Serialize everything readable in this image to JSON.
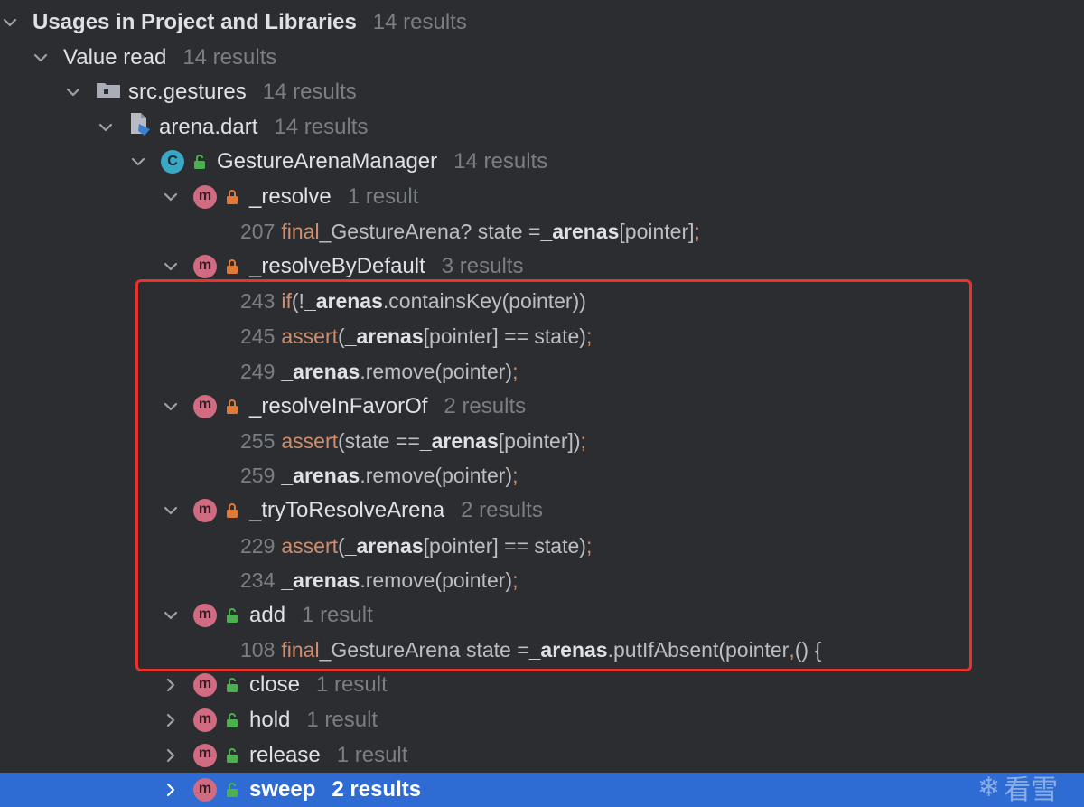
{
  "window": {
    "tree": [
      {
        "type": "node",
        "indent": 0,
        "expanded": true,
        "icon": "none",
        "name": "Usages in Project and Libraries",
        "count": "14 results",
        "bold": true
      },
      {
        "type": "node",
        "indent": 1,
        "expanded": true,
        "icon": "none",
        "name": "Value read",
        "count": "14 results"
      },
      {
        "type": "node",
        "indent": 2,
        "expanded": true,
        "icon": "folder-icon",
        "name": "src.gestures",
        "count": "14 results"
      },
      {
        "type": "node",
        "indent": 3,
        "expanded": true,
        "icon": "dart-file-icon",
        "name": "arena.dart",
        "count": "14 results"
      },
      {
        "type": "node",
        "indent": 4,
        "expanded": true,
        "icon": "class-icon",
        "access": "public",
        "name": "GestureArenaManager",
        "count": "14 results"
      },
      {
        "type": "node",
        "indent": 5,
        "expanded": true,
        "icon": "method-icon",
        "access": "private",
        "name": "_resolve",
        "count": "1 result"
      },
      {
        "type": "code",
        "line": "207",
        "tokens": [
          {
            "t": "final",
            "c": "kw"
          },
          {
            "t": " _GestureArena? state = ",
            "c": "pl"
          },
          {
            "t": "_arenas",
            "c": "hl"
          },
          {
            "t": "[pointer]",
            "c": "pl"
          },
          {
            "t": ";",
            "c": "kw"
          }
        ]
      },
      {
        "type": "node",
        "indent": 5,
        "expanded": true,
        "icon": "method-icon",
        "access": "private",
        "name": "_resolveByDefault",
        "count": "3 results"
      },
      {
        "type": "code",
        "line": "243",
        "tokens": [
          {
            "t": "if",
            "c": "kw"
          },
          {
            "t": " (!",
            "c": "pl"
          },
          {
            "t": "_arenas",
            "c": "hl"
          },
          {
            "t": ".containsKey(pointer))",
            "c": "pl"
          }
        ]
      },
      {
        "type": "code",
        "line": "245",
        "tokens": [
          {
            "t": "assert",
            "c": "kw"
          },
          {
            "t": "(",
            "c": "pl"
          },
          {
            "t": "_arenas",
            "c": "hl"
          },
          {
            "t": "[pointer] == state)",
            "c": "pl"
          },
          {
            "t": ";",
            "c": "kw"
          }
        ]
      },
      {
        "type": "code",
        "line": "249",
        "tokens": [
          {
            "t": "_arenas",
            "c": "hl"
          },
          {
            "t": ".remove(pointer)",
            "c": "pl"
          },
          {
            "t": ";",
            "c": "kw"
          }
        ]
      },
      {
        "type": "node",
        "indent": 5,
        "expanded": true,
        "icon": "method-icon",
        "access": "private",
        "name": "_resolveInFavorOf",
        "count": "2 results"
      },
      {
        "type": "code",
        "line": "255",
        "tokens": [
          {
            "t": "assert",
            "c": "kw"
          },
          {
            "t": "(state == ",
            "c": "pl"
          },
          {
            "t": "_arenas",
            "c": "hl"
          },
          {
            "t": "[pointer])",
            "c": "pl"
          },
          {
            "t": ";",
            "c": "kw"
          }
        ]
      },
      {
        "type": "code",
        "line": "259",
        "tokens": [
          {
            "t": "_arenas",
            "c": "hl"
          },
          {
            "t": ".remove(pointer)",
            "c": "pl"
          },
          {
            "t": ";",
            "c": "kw"
          }
        ]
      },
      {
        "type": "node",
        "indent": 5,
        "expanded": true,
        "icon": "method-icon",
        "access": "private",
        "name": "_tryToResolveArena",
        "count": "2 results"
      },
      {
        "type": "code",
        "line": "229",
        "tokens": [
          {
            "t": "assert",
            "c": "kw"
          },
          {
            "t": "(",
            "c": "pl"
          },
          {
            "t": "_arenas",
            "c": "hl"
          },
          {
            "t": "[pointer] == state)",
            "c": "pl"
          },
          {
            "t": ";",
            "c": "kw"
          }
        ]
      },
      {
        "type": "code",
        "line": "234",
        "tokens": [
          {
            "t": "_arenas",
            "c": "hl"
          },
          {
            "t": ".remove(pointer)",
            "c": "pl"
          },
          {
            "t": ";",
            "c": "kw"
          }
        ]
      },
      {
        "type": "node",
        "indent": 5,
        "expanded": true,
        "icon": "method-icon",
        "access": "public",
        "name": "add",
        "count": "1 result"
      },
      {
        "type": "code",
        "line": "108",
        "tokens": [
          {
            "t": "final",
            "c": "kw"
          },
          {
            "t": " _GestureArena state = ",
            "c": "pl"
          },
          {
            "t": "_arenas",
            "c": "hl"
          },
          {
            "t": ".putIfAbsent(pointer",
            "c": "pl"
          },
          {
            "t": ",",
            "c": "kw"
          },
          {
            "t": " () {",
            "c": "pl"
          }
        ]
      },
      {
        "type": "node",
        "indent": 5,
        "expanded": false,
        "icon": "method-icon",
        "access": "public",
        "name": "close",
        "count": "1 result"
      },
      {
        "type": "node",
        "indent": 5,
        "expanded": false,
        "icon": "method-icon",
        "access": "public",
        "name": "hold",
        "count": "1 result"
      },
      {
        "type": "node",
        "indent": 5,
        "expanded": false,
        "icon": "method-icon",
        "access": "public",
        "name": "release",
        "count": "1 result"
      },
      {
        "type": "node",
        "indent": 5,
        "expanded": false,
        "icon": "method-icon",
        "access": "public",
        "name": "sweep",
        "count": "2 results",
        "selected": true
      }
    ]
  },
  "badges": {
    "class_letter": "C",
    "method_letter": "m"
  },
  "watermark": {
    "text": "看雪"
  },
  "colors": {
    "background": "#2b2d30",
    "selection": "#2e6bd3",
    "keyword": "#cf8e6d",
    "method_badge": "#d06b82",
    "class_badge": "#3aa7c5",
    "private_lock": "#e07a3a",
    "public_lock": "#4caf50",
    "highlight_box": "#e8322c"
  }
}
